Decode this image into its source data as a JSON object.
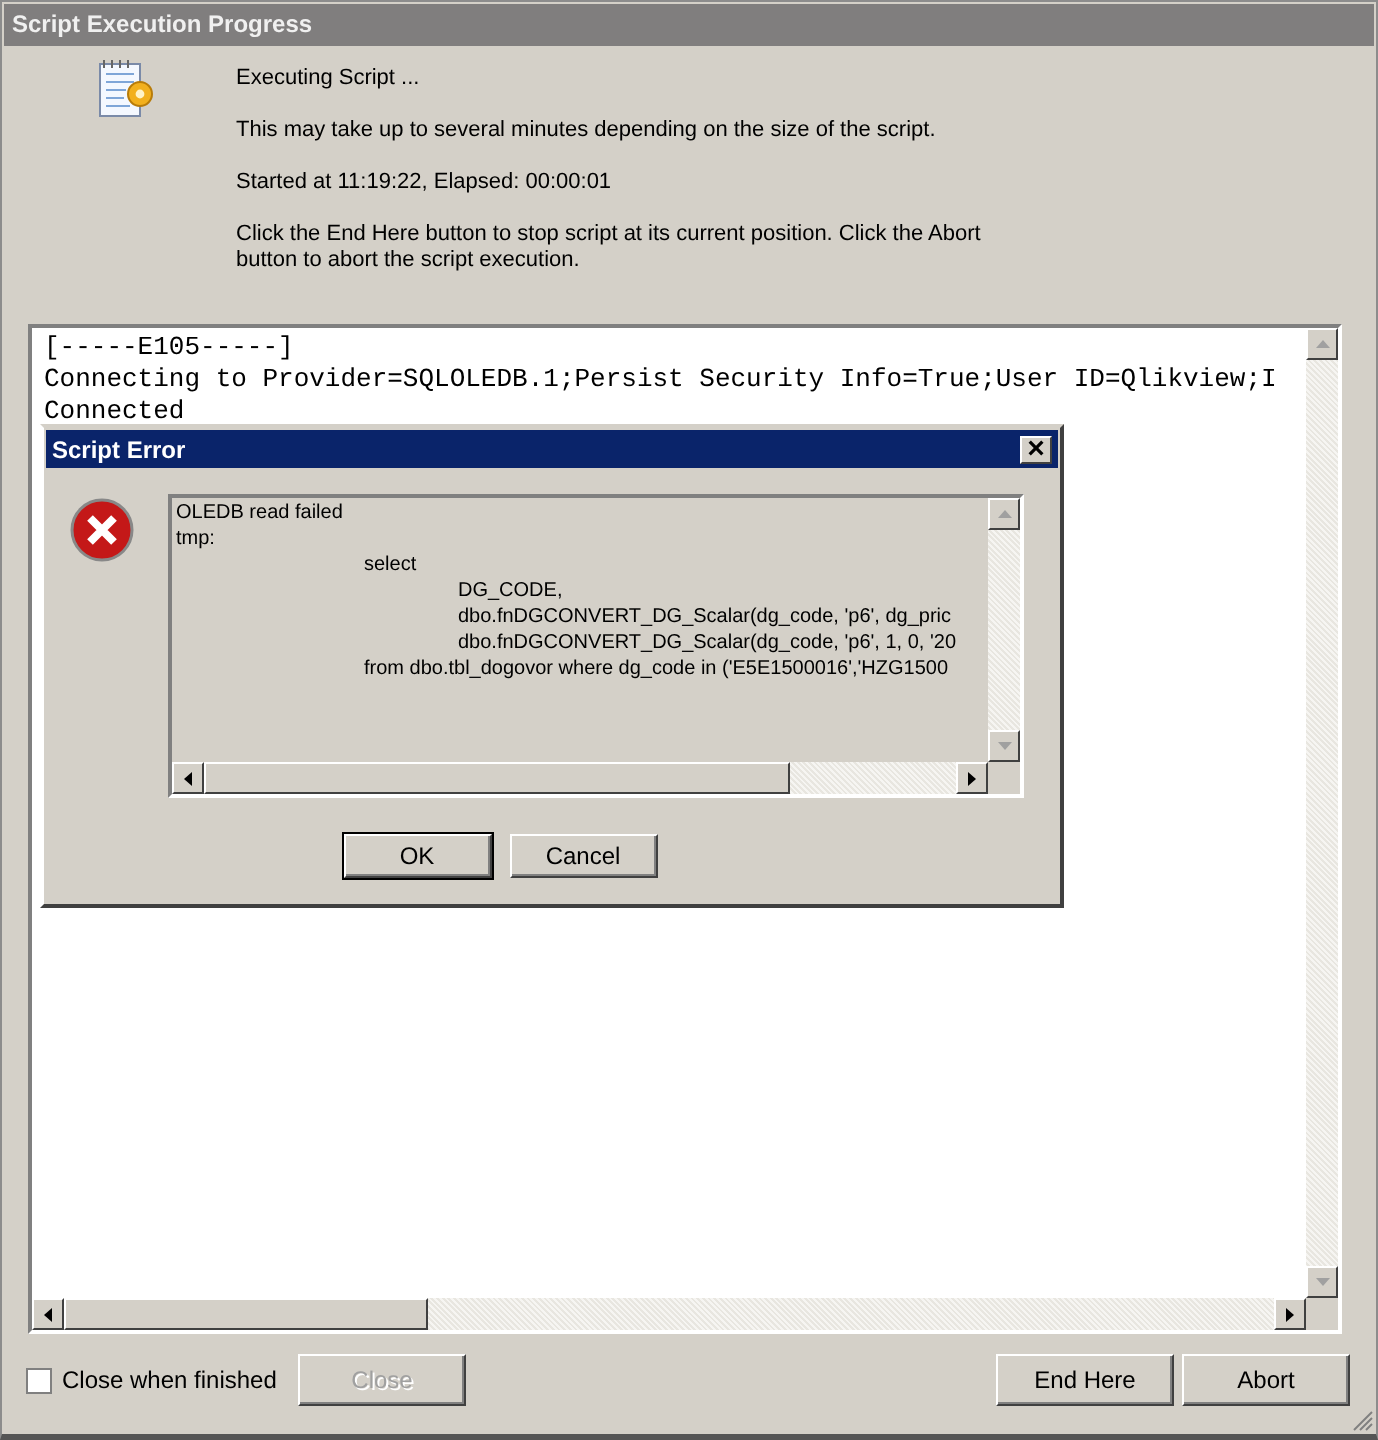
{
  "window": {
    "title": "Script Execution Progress"
  },
  "messages": [
    "Executing Script ...",
    "This may take up to several minutes depending on the size of the script.",
    "Started at 11:19:22, Elapsed: 00:00:01",
    "Click the End Here button to stop script at its current position. Click the Abort button to abort the script execution."
  ],
  "log": {
    "lines": [
      "[-----E105-----]",
      "Connecting to Provider=SQLOLEDB.1;Persist Security Info=True;User ID=Qlikview;I",
      "Connected"
    ]
  },
  "error_dialog": {
    "title": "Script Error",
    "close_label": "×",
    "message_lines": [
      "OLEDB read failed",
      "tmp:",
      "\t\tselect",
      "\t\t\tDG_CODE,",
      "\t\t\tdbo.fnDGCONVERT_DG_Scalar(dg_code, 'p6', dg_pric",
      "\t\t\tdbo.fnDGCONVERT_DG_Scalar(dg_code, 'p6', 1, 0, '20",
      "\t\tfrom dbo.tbl_dogovor where dg_code in ('E5E1500016','HZG1500"
    ],
    "buttons": [
      {
        "label": "OK",
        "default": true
      },
      {
        "label": "Cancel",
        "default": false
      }
    ]
  },
  "close_when_finished": {
    "label": "Close when finished",
    "checked": false
  },
  "buttons": [
    {
      "label": "Close",
      "disabled": true
    },
    {
      "label": "End Here",
      "disabled": false
    },
    {
      "label": "Abort",
      "disabled": false
    }
  ]
}
